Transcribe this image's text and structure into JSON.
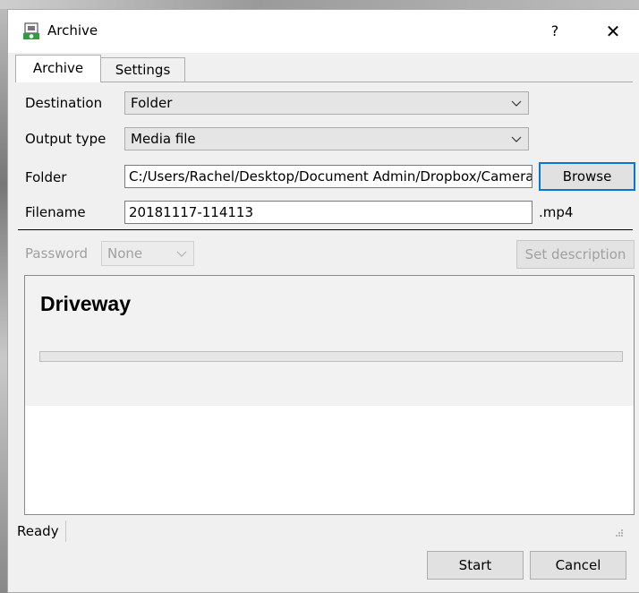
{
  "window": {
    "title": "Archive",
    "help_label": "?",
    "close_label": "✕"
  },
  "tabs": [
    {
      "label": "Archive",
      "active": true
    },
    {
      "label": "Settings",
      "active": false
    }
  ],
  "form": {
    "destination": {
      "label": "Destination",
      "value": "Folder"
    },
    "output_type": {
      "label": "Output type",
      "value": "Media file"
    },
    "folder": {
      "label": "Folder",
      "value": "C:/Users/Rachel/Desktop/Document Admin/Dropbox/Camera Uploads",
      "browse_label": "Browse"
    },
    "filename": {
      "label": "Filename",
      "value": "20181117-114113",
      "extension": ".mp4"
    },
    "password": {
      "label": "Password",
      "value": "None"
    },
    "set_description_label": "Set description"
  },
  "items": [
    {
      "name": "Driveway",
      "progress": 0
    }
  ],
  "status": {
    "text": "Ready"
  },
  "buttons": {
    "start": "Start",
    "cancel": "Cancel"
  },
  "colors": {
    "focus_border": "#0078d7",
    "progress_fill": "#06b025"
  },
  "icons": {
    "app": "archive-camera-icon",
    "dropdown": "chevron-down-icon",
    "grip": "resize-grip-icon"
  }
}
